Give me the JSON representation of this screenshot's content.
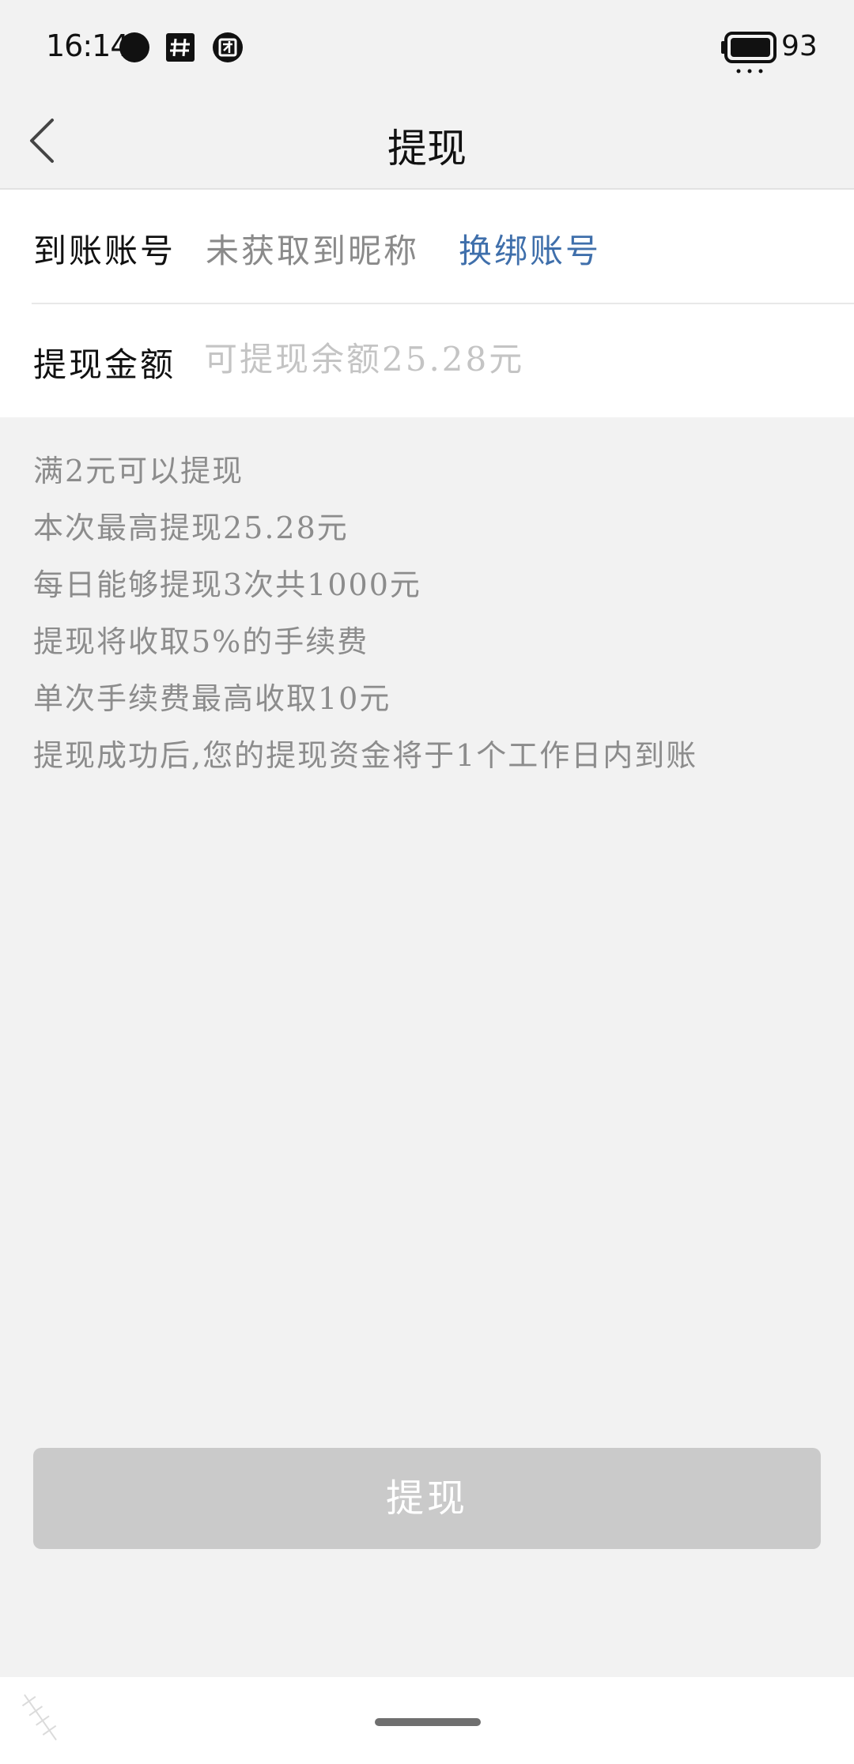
{
  "status_bar": {
    "time": "16:14",
    "battery_level": "93",
    "icons": [
      "dot-icon",
      "hash-app-icon",
      "team-app-icon",
      "battery-icon"
    ]
  },
  "header": {
    "title": "提现",
    "back_icon": "chevron-left-icon"
  },
  "form": {
    "account": {
      "label": "到账账号",
      "value": "未获取到昵称",
      "rebind_label": "换绑账号"
    },
    "amount": {
      "label": "提现金额",
      "value": "",
      "placeholder": "可提现余额25.28元"
    }
  },
  "rules": [
    "满2元可以提现",
    "本次最高提现25.28元",
    "每日能够提现3次共1000元",
    "提现将收取5%的手续费",
    "单次手续费最高收取10元",
    "提现成功后,您的提现资金将于1个工作日内到账"
  ],
  "submit_label": "提现",
  "colors": {
    "background": "#f2f2f2",
    "link": "#3f6fab",
    "button_disabled": "#cacaca"
  }
}
